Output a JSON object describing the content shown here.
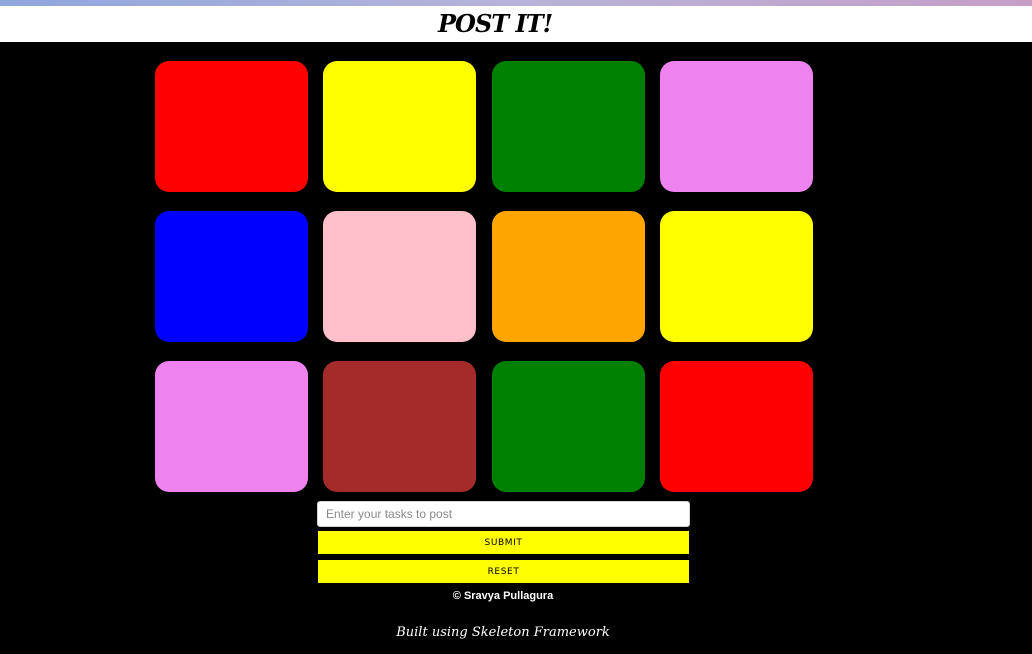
{
  "header": {
    "brand": "POST IT!"
  },
  "notes": [
    {
      "color": "#ff0000"
    },
    {
      "color": "#ffff00"
    },
    {
      "color": "#008000"
    },
    {
      "color": "#ee82ee"
    },
    {
      "color": "#0000ff"
    },
    {
      "color": "#ffc0cb"
    },
    {
      "color": "#ffa500"
    },
    {
      "color": "#ffff00"
    },
    {
      "color": "#ee82ee"
    },
    {
      "color": "#a52a2a"
    },
    {
      "color": "#008000"
    },
    {
      "color": "#ff0000"
    }
  ],
  "form": {
    "task_placeholder": "Enter your tasks to post",
    "submit_label": "SUBMIT",
    "reset_label": "RESET",
    "button_color": "#ffff00"
  },
  "footer": {
    "copyright": "© Sravya Pullagura",
    "built_with": "Built using Skeleton Framework"
  }
}
